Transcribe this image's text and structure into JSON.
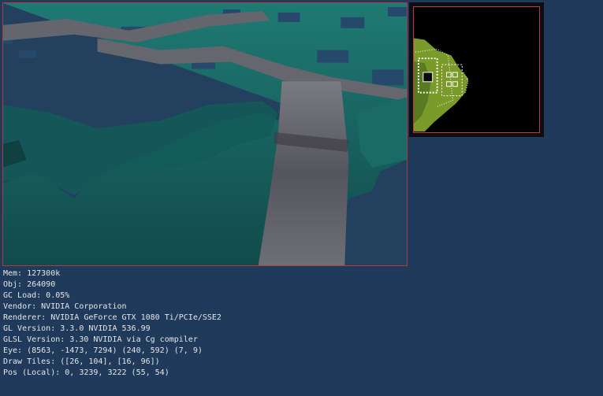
{
  "debug": {
    "mem": "Mem: 127300k",
    "obj": "Obj: 264090",
    "gc": "GC Load: 0.05%",
    "vendor": "Vendor: NVIDIA Corporation",
    "renderer": "Renderer: NVIDIA GeForce GTX 1080 Ti/PCIe/SSE2",
    "gl_version": "GL Version: 3.3.0 NVIDIA 536.99",
    "glsl_version": "GLSL Version: 3.30 NVIDIA via Cg compiler",
    "eye": "Eye: (8563, -1473, 7294) (240, 592) (7, 9)",
    "draw_tiles": "Draw Tiles: ([26, 104], [16, 96])",
    "pos_local": "Pos (Local): 0, 3239, 3222 (55, 54)"
  },
  "colors": {
    "background": "#1f3a5a",
    "viewport_border": "#b33a3a",
    "minimap_border": "#c43a3a",
    "terrain_teal": "#1a6e68",
    "road_gray": "#6a6a72",
    "minimap_terrain": "#7a9a2a"
  }
}
